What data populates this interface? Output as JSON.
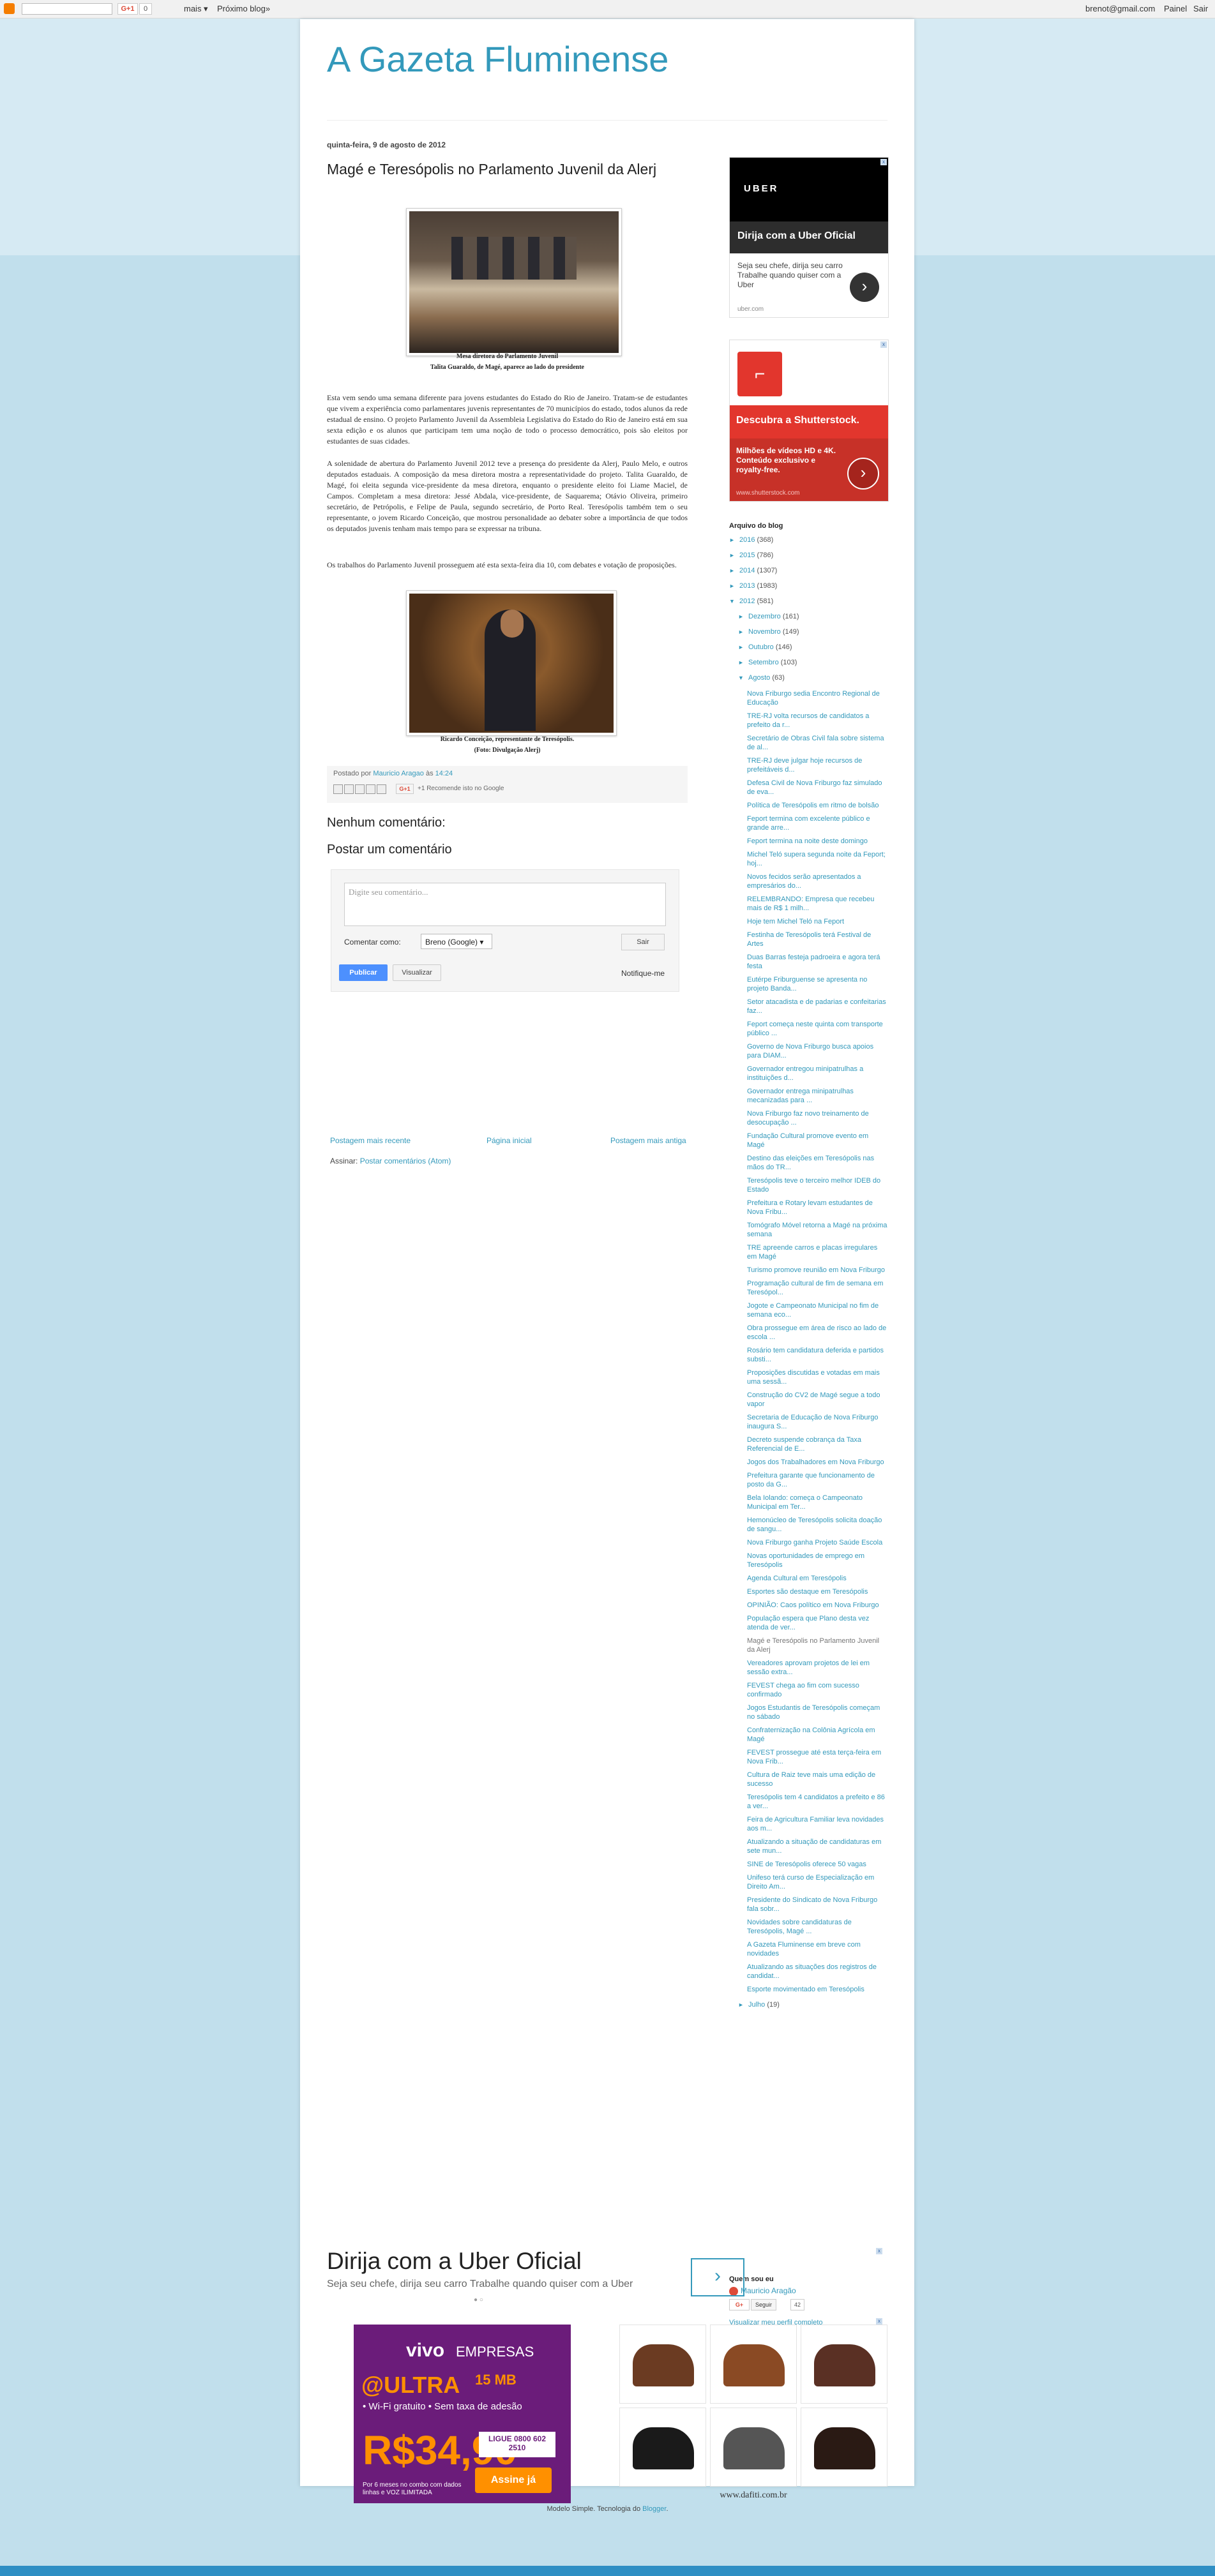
{
  "navbar": {
    "more": "mais ▾",
    "next_blog": "Próximo blog»",
    "gplus": "G+1",
    "gplus_count": "0",
    "email": "brenot@gmail.com",
    "painel": "Painel",
    "sair": "Sair"
  },
  "blog": {
    "title": "A Gazeta Fluminense"
  },
  "post": {
    "date": "quinta-feira, 9 de agosto de 2012",
    "title": "Magé e Teresópolis no Parlamento Juvenil da Alerj",
    "caption1_line1": "Mesa diretora do Parlamento Juvenil",
    "caption1_line2": "Talita Guaraldo, de Magé, aparece ao lado do presidente",
    "para1": "Esta vem sendo uma semana diferente para jovens estudantes do Estado do Rio de Janeiro.  Tratam-se de estudantes que vivem a experiência como parlamentares juvenis representantes de 70 municípios do estado, todos alunos da rede estadual de ensino.  O projeto Parlamento Juvenil da Assembleia Legislativa do Estado do Rio de Janeiro está em sua sexta edição e os alunos que participam tem uma noção de todo o processo democrático, pois são eleitos por estudantes de suas cidades.",
    "para2": "A solenidade de abertura do Parlamento Juvenil 2012 teve a presença do presidente da Alerj, Paulo Melo, e outros deputados estaduais. A composição da mesa diretora mostra a representatividade do projeto. Talita Guaraldo, de Magé, foi eleita segunda vice-presidente da mesa diretora, enquanto o presidente eleito foi Liame Maciel, de Campos. Completam a mesa diretora: Jessé Abdala, vice-presidente, de Saquarema; Otávio Oliveira, primeiro secretário, de Petrópolis, e Felipe de Paula, segundo secretário, de Porto Real. Teresópolis também tem o seu representante, o jovem Ricardo Conceição, que mostrou personalidade ao debater sobre a importância de que todos os deputados juvenis tenham mais tempo para se expressar na tribuna.",
    "para3": "Os trabalhos do Parlamento Juvenil prosseguem até esta sexta-feira dia 10, com debates e votação de proposições.",
    "caption2_line1": "Ricardo Conceição, representante de Teresópolis.",
    "caption2_line2": "(Foto: Divulgação Alerj)",
    "posted_by_prefix": "Postado por",
    "author": "Mauricio Aragao",
    "posted_at_prefix": "às",
    "time": "14:24",
    "gplus": "G+1",
    "gplus_count": "+1",
    "recommend": "Recomende isto no Google",
    "no_comments": "Nenhum comentário:",
    "post_comment": "Postar um comentário",
    "comment_placeholder": "Digite seu comentário...",
    "comment_as": "Comentar como:",
    "comment_as_value": "Breno (Google) ▾",
    "sair_button": "Sair",
    "publish": "Publicar",
    "preview": "Visualizar",
    "notify": "Notifique-me"
  },
  "pager": {
    "newer": "Postagem mais recente",
    "home": "Página inicial",
    "older": "Postagem mais antiga"
  },
  "subscribe": {
    "label": "Assinar:",
    "link": "Postar comentários (Atom)"
  },
  "sidebar": {
    "uber_ad": {
      "logo": "UBER",
      "headline": "Dirija com a Uber Oficial",
      "text": "Seja seu chefe, dirija seu carro Trabalhe quando quiser com a Uber",
      "url": "uber.com"
    },
    "shutterstock_ad": {
      "headline": "Descubra a Shutterstock.",
      "text": "Milhões de vídeos HD e 4K. Conteúdo exclusivo e royalty-free.",
      "url": "www.shutterstock.com"
    },
    "archive_title": "Arquivo do blog",
    "years": [
      {
        "toggle": "►",
        "label": "2016",
        "count": "(368)"
      },
      {
        "toggle": "►",
        "label": "2015",
        "count": "(786)"
      },
      {
        "toggle": "►",
        "label": "2014",
        "count": "(1307)"
      },
      {
        "toggle": "►",
        "label": "2013",
        "count": "(1983)"
      },
      {
        "toggle": "▼",
        "label": "2012",
        "count": "(581)"
      }
    ],
    "months": [
      {
        "toggle": "►",
        "label": "Dezembro",
        "count": "(161)"
      },
      {
        "toggle": "►",
        "label": "Novembro",
        "count": "(149)"
      },
      {
        "toggle": "►",
        "label": "Outubro",
        "count": "(146)"
      },
      {
        "toggle": "►",
        "label": "Setembro",
        "count": "(103)"
      },
      {
        "toggle": "▼",
        "label": "Agosto",
        "count": "(63)"
      }
    ],
    "july": {
      "toggle": "►",
      "label": "Julho",
      "count": "(19)"
    },
    "posts": [
      "Nova Friburgo sedia Encontro Regional de Educação",
      "TRE-RJ volta recursos de candidatos a prefeito da r...",
      "Secretário de Obras Civil fala sobre sistema de al...",
      "TRE-RJ deve julgar hoje recursos de prefeitáveis d...",
      "Defesa Civil de Nova Friburgo faz simulado de eva...",
      "Política de Teresópolis em ritmo de bolsão",
      "Feport termina com excelente público e grande arre...",
      "Feport termina na noite deste domingo",
      "Michel Teló supera segunda noite da Feport; hoj...",
      "Novos fecidos serão apresentados a empresários do...",
      "RELEMBRANDO: Empresa que recebeu mais de R$ 1 milh...",
      "Hoje tem Michel Teló na Feport",
      "Festinha de Teresópolis terá Festival de Artes",
      "Duas Barras festeja padroeira e agora terá festa",
      "Eutérpe Friburguense se apresenta no projeto Banda...",
      "Setor atacadista e de padarias e confeitarias faz...",
      "Feport começa neste quinta com transporte público ...",
      "Governo de Nova Friburgo busca apoios para DIAM...",
      "Governador entregou minipatrulhas a instituições d...",
      "Governador entrega minipatrulhas mecanizadas para ...",
      "Nova Friburgo faz novo treinamento de desocupação ...",
      "Fundação Cultural promove evento em Magé",
      "Destino das eleições em Teresópolis nas mãos do TR...",
      "Teresópolis teve o terceiro melhor IDEB do Estado",
      "Prefeitura e Rotary levam estudantes de Nova Fribu...",
      "Tomógrafo Móvel retorna a Magé na próxima semana",
      "TRE apreende carros e placas irregulares em Magé",
      "Turismo promove reunião em Nova Friburgo",
      "Programação cultural de fim de semana em Teresópol...",
      "Jogote e Campeonato Municipal no fim de semana eco...",
      "Obra prossegue em área de risco ao lado de escola ...",
      "Rosário tem candidatura deferida e partidos substi...",
      "Proposições discutidas e votadas em mais uma sessã...",
      "Construção do CV2 de Magé segue a todo vapor",
      "Secretaria de Educação de Nova Friburgo inaugura S...",
      "Decreto suspende cobrança da Taxa Referencial de E...",
      "Jogos dos Trabalhadores em Nova Friburgo",
      "Prefeitura garante que funcionamento de posto da G...",
      "Bela Iolando: começa o Campeonato Municipal em Ter...",
      "Hemonúcleo de Teresópolis solicita doação de sangu...",
      "Nova Friburgo ganha Projeto Saúde Escola",
      "Novas oportunidades de emprego em Teresópolis",
      "Agenda Cultural em Teresópolis",
      "Esportes são destaque em Teresópolis",
      "OPINIÃO: Caos político em Nova Friburgo",
      "População espera que Plano desta vez atenda de ver...",
      "Magé e Teresópolis no Parlamento Juvenil da Alerj",
      "Vereadores aprovam projetos de lei em sessão extra...",
      "FEVEST chega ao fim com sucesso confirmado",
      "Jogos Estudantis de Teresópolis começam no sábado",
      "Confraternização na Colônia Agrícola em Magé",
      "FEVEST prossegue até esta terça-feira em Nova Frib...",
      "Cultura de Raiz teve mais uma edição de sucesso",
      "Teresópolis tem 4 candidatos a prefeito e 86 a ver...",
      "Feira de Agricultura Familiar leva novidades aos m...",
      "Atualizando a situação de candidaturas em sete mun...",
      "SINE de Teresópolis oferece 50 vagas",
      "Unifeso terá curso de Especialização em Direito Am...",
      "Presidente do Sindicato de Nova Friburgo fala sobr...",
      "Novidades sobre candidaturas de Teresópolis, Magé ...",
      "A Gazeta Fluminense em breve com novidades",
      "Atualizando as situações dos registros de candidat...",
      "Esporte movimentado em Teresópolis"
    ],
    "current_post_index": 46,
    "profile_title": "Quem sou eu",
    "profile_name": "Mauricio Aragão",
    "follow_gplus": "G+",
    "follow_button": "Seguir",
    "follow_count": "42",
    "profile_link": "Visualizar meu perfil completo"
  },
  "bottom_ads": {
    "uber": {
      "headline": "Dirija com a Uber Oficial",
      "text": "Seja seu chefe, dirija seu carro Trabalhe quando quiser com a Uber",
      "button": "›",
      "dots": "● ○"
    },
    "vivo": {
      "brand": "vivo",
      "empresas": "EMPRESAS",
      "ultra": "@ULTRA",
      "mb": "15 MB",
      "wifi": "• Wi-Fi gratuito • Sem taxa de adesão",
      "price": "R$34,90",
      "ligue": "LIGUE 0800 602 2510",
      "assine": "Assine já",
      "fine": "Por 6 meses no combo com dados linhas e VOZ ILIMITADA"
    },
    "shoes_url": "www.dafiti.com.br"
  },
  "powered_by": {
    "prefix": "Modelo Simple. Tecnologia do",
    "link": "Blogger",
    "suffix": "."
  },
  "colors": {
    "accent": "#3399bb",
    "background": "#c1dfec"
  }
}
